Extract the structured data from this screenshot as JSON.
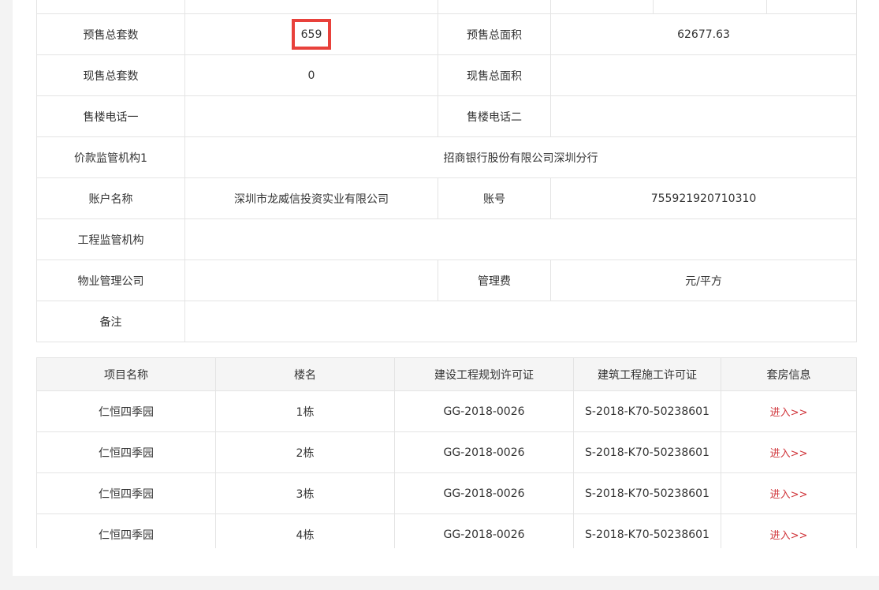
{
  "info": {
    "presale_total_units_label": "预售总套数",
    "presale_total_units_value": "659",
    "presale_total_area_label": "预售总面积",
    "presale_total_area_value": "62677.63",
    "current_sale_units_label": "现售总套数",
    "current_sale_units_value": "0",
    "current_sale_area_label": "现售总面积",
    "current_sale_area_value": "",
    "sales_phone1_label": "售楼电话一",
    "sales_phone1_value": "",
    "sales_phone2_label": "售楼电话二",
    "sales_phone2_value": "",
    "fund_supervisor_label": "价款监管机构1",
    "fund_supervisor_value": "招商银行股份有限公司深圳分行",
    "account_name_label": "账户名称",
    "account_name_value": "深圳市龙威信投资实业有限公司",
    "account_no_label": "账号",
    "account_no_value": "755921920710310",
    "engineering_supervisor_label": "工程监管机构",
    "engineering_supervisor_value": "",
    "property_company_label": "物业管理公司",
    "property_company_value": "",
    "management_fee_label": "管理费",
    "management_fee_value": "元/平方",
    "remarks_label": "备注",
    "remarks_value": ""
  },
  "buildings": {
    "headers": [
      "项目名称",
      "楼名",
      "建设工程规划许可证",
      "建筑工程施工许可证",
      "套房信息"
    ],
    "rows": [
      {
        "project": "仁恒四季园",
        "building": "1栋",
        "plan_permit": "GG-2018-0026",
        "construction_permit": "S-2018-K70-50238601",
        "link": "进入>>"
      },
      {
        "project": "仁恒四季园",
        "building": "2栋",
        "plan_permit": "GG-2018-0026",
        "construction_permit": "S-2018-K70-50238601",
        "link": "进入>>"
      },
      {
        "project": "仁恒四季园",
        "building": "3栋",
        "plan_permit": "GG-2018-0026",
        "construction_permit": "S-2018-K70-50238601",
        "link": "进入>>"
      },
      {
        "project": "仁恒四季园",
        "building": "4栋",
        "plan_permit": "GG-2018-0026",
        "construction_permit": "S-2018-K70-50238601",
        "link": "进入>>"
      }
    ]
  },
  "colors": {
    "highlight_border": "#e8413b",
    "link": "#d0343a",
    "header_bg": "#f5f5f5",
    "grid": "#e4e4e4"
  }
}
